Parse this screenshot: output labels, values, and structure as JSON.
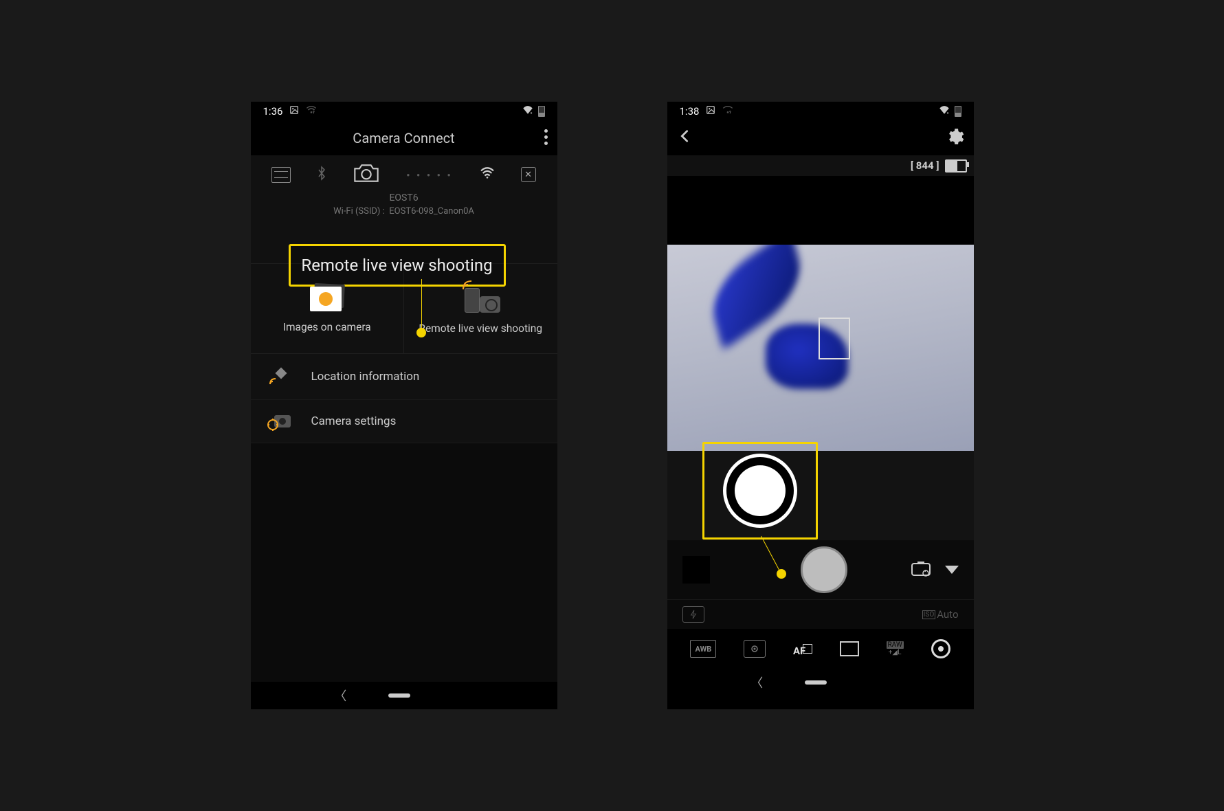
{
  "phone1": {
    "status": {
      "time": "1:36"
    },
    "header": {
      "title": "Camera Connect"
    },
    "camera": {
      "name": "EOST6",
      "ssid_label": "Wi-Fi (SSID) :",
      "ssid_value": "EOST6-098_Canon0A"
    },
    "callout_label": "Remote live view shooting",
    "grid": {
      "images_label": "Images on camera",
      "remote_label": "Remote live view shooting"
    },
    "rows": {
      "location": "Location information",
      "settings": "Camera settings"
    }
  },
  "phone2": {
    "status": {
      "time": "1:38"
    },
    "info": {
      "shots": "[ 844 ]"
    },
    "iso": {
      "label": "Auto"
    },
    "bottom": {
      "awb": "AWB",
      "af": "AF",
      "raw1": "RAW",
      "raw2": "+◢L"
    }
  }
}
